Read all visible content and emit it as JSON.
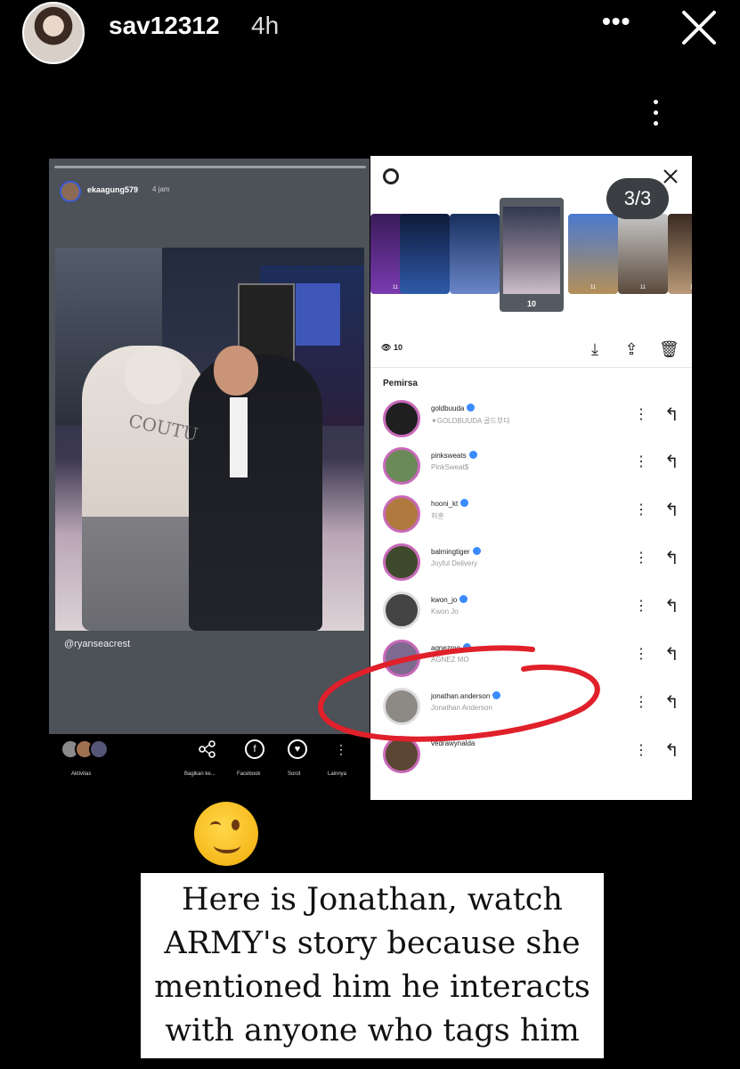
{
  "header": {
    "username": "sav12312",
    "time": "4h",
    "more": "•••"
  },
  "left_story": {
    "username": "ekaagung579",
    "time": "4 jam",
    "photo_text": "COUTU",
    "mention": "@ryanseacrest",
    "bottom_actions": [
      {
        "label": "Aktivitas",
        "icon": "avatars-icon"
      },
      {
        "label": "Bagikan ke...",
        "icon": "share-icon"
      },
      {
        "label": "Facebook",
        "icon": "facebook-icon"
      },
      {
        "label": "Sorot",
        "icon": "highlight-icon"
      },
      {
        "label": "Lainnya",
        "icon": "more-icon"
      }
    ]
  },
  "viewer_panel": {
    "page_badge": "3/3",
    "thumb_counts": [
      "11",
      "",
      "",
      "10",
      "11",
      "11",
      "11"
    ],
    "selected_count": "10",
    "views": "10",
    "section_title": "Pemirsa",
    "viewers": [
      {
        "name": "goldbuuda",
        "subtitle": "✦GOLDBUUDA 골드부다",
        "color": "#1f1f1f"
      },
      {
        "name": "pinksweats",
        "subtitle": "PinkSweat$",
        "color": "#6a8a58"
      },
      {
        "name": "hooni_kt",
        "subtitle": "허훈",
        "color": "#b07a3e"
      },
      {
        "name": "balmingtiger",
        "subtitle": "Joyful Delivery",
        "color": "#3e4a2c"
      },
      {
        "name": "kwon_jo",
        "subtitle": "Kwon Jo",
        "color": "#444"
      },
      {
        "name": "agnezmo",
        "subtitle": "AGNEZ MO",
        "color": "#7d6a8e"
      },
      {
        "name": "jonathan.anderson",
        "subtitle": "Jonathan Anderson",
        "color": "#8d8a86"
      },
      {
        "name": "vedrawynalda",
        "subtitle": "",
        "color": "#5a4632"
      }
    ]
  },
  "caption": "Here is Jonathan, watch ARMY's story because she mentioned him he interacts with anyone who tags him",
  "colors": {
    "highlight_circle": "#e0202a",
    "story_ring": "#c869b8",
    "verified": "#3a8bff"
  }
}
